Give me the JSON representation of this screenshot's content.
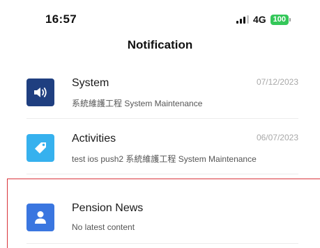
{
  "status_bar": {
    "time": "16:57",
    "network": "4G",
    "battery": "100"
  },
  "header": {
    "title": "Notification"
  },
  "notifications": [
    {
      "title": "System",
      "date": "07/12/2023",
      "subtitle": "系統維護工程 System Maintenance",
      "icon": "speaker-icon",
      "icon_color": "#1f3f80"
    },
    {
      "title": "Activities",
      "date": "06/07/2023",
      "subtitle": "test ios push2 系統維護工程 System Maintenance",
      "icon": "tag-icon",
      "icon_color": "#36b1ee"
    },
    {
      "title": "Pension News",
      "date": "",
      "subtitle": "No latest content",
      "icon": "person-icon",
      "icon_color": "#3a76e0"
    }
  ],
  "colors": {
    "highlight_border": "#d9333a",
    "battery": "#34c759"
  }
}
